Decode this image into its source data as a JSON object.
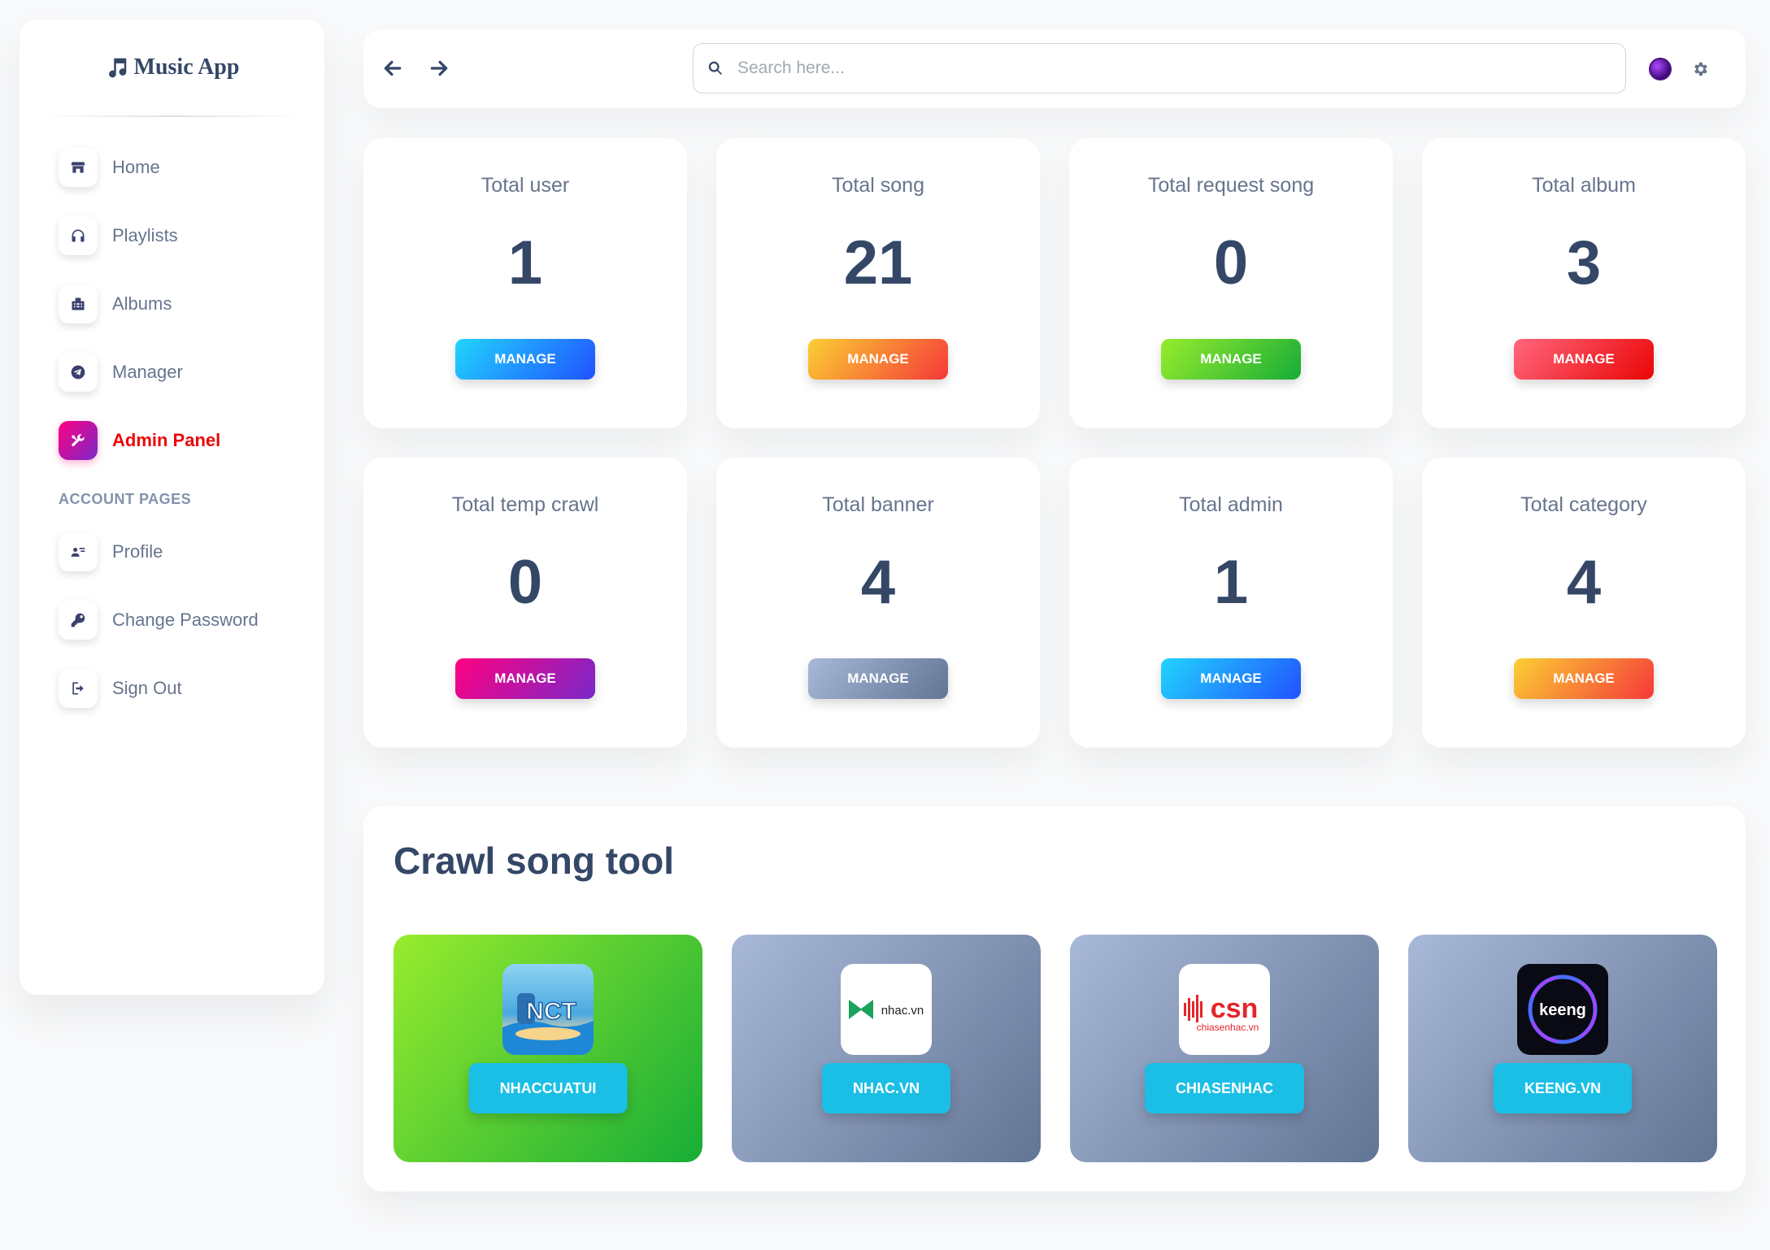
{
  "brand": {
    "name": "Music App"
  },
  "sidebar": {
    "items": [
      {
        "label": "Home",
        "icon": "shop-icon"
      },
      {
        "label": "Playlists",
        "icon": "headphones-icon"
      },
      {
        "label": "Albums",
        "icon": "building-icon"
      },
      {
        "label": "Manager",
        "icon": "send-icon"
      },
      {
        "label": "Admin Panel",
        "icon": "tools-icon",
        "active": true
      }
    ],
    "section_title": "ACCOUNT PAGES",
    "account_items": [
      {
        "label": "Profile",
        "icon": "user-icon"
      },
      {
        "label": "Change Password",
        "icon": "key-icon"
      },
      {
        "label": "Sign Out",
        "icon": "sign-out-icon"
      }
    ]
  },
  "topbar": {
    "search_placeholder": "Search here..."
  },
  "stats": [
    {
      "title": "Total user",
      "value": "1",
      "button": "MANAGE",
      "color": "#21d4fd"
    },
    {
      "title": "Total song",
      "value": "21",
      "button": "MANAGE",
      "color": "#fbcf33"
    },
    {
      "title": "Total request song",
      "value": "0",
      "button": "MANAGE",
      "color": "#98ec2d"
    },
    {
      "title": "Total album",
      "value": "3",
      "button": "MANAGE",
      "color": "#ff667c"
    },
    {
      "title": "Total temp crawl",
      "value": "0",
      "button": "MANAGE",
      "color": "#ff0080"
    },
    {
      "title": "Total banner",
      "value": "4",
      "button": "MANAGE",
      "color": "#a8b8d8"
    },
    {
      "title": "Total admin",
      "value": "1",
      "button": "MANAGE",
      "color": "#21d4fd"
    },
    {
      "title": "Total category",
      "value": "4",
      "button": "MANAGE",
      "color": "#fbcf33"
    }
  ],
  "crawl": {
    "title": "Crawl song tool",
    "sources": [
      {
        "button": "NHACCUATUI",
        "logo_text": "NCT"
      },
      {
        "button": "NHAC.VN",
        "logo_text": "nhac.vn"
      },
      {
        "button": "CHIASENHAC",
        "logo_text": "csn",
        "logo_subtext": "chiasenhac.vn"
      },
      {
        "button": "KEENG.VN",
        "logo_text": "keeng"
      }
    ]
  }
}
